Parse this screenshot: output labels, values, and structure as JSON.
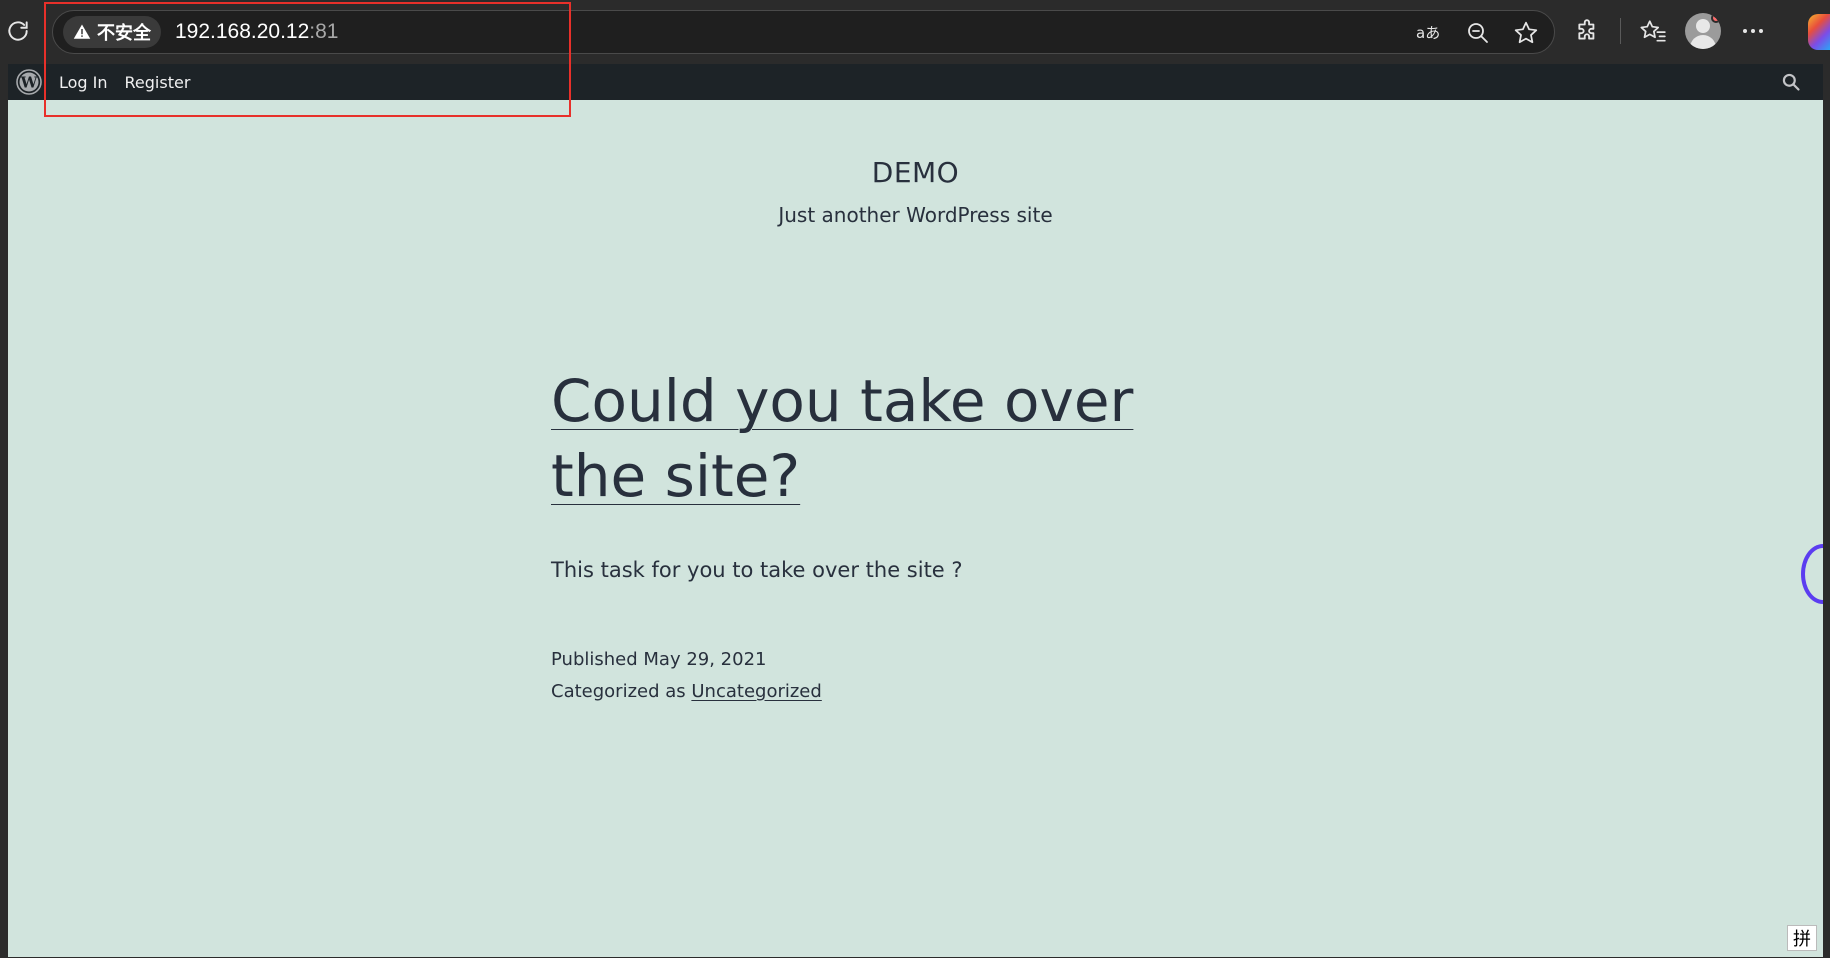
{
  "browser": {
    "security_label": "不安全",
    "url_host": "192.168.20.12",
    "url_port": ":81",
    "icons": [
      "reload-icon",
      "warning-icon",
      "read-aloud-icon",
      "zoom-out-icon",
      "favorite-star-icon",
      "extensions-icon",
      "favorites-icon",
      "profile-avatar-icon",
      "more-icon",
      "copilot-icon"
    ]
  },
  "admin_bar": {
    "login": "Log In",
    "register": "Register"
  },
  "site": {
    "title": "DEMO",
    "tagline": "Just another WordPress site"
  },
  "post": {
    "title": "Could you take over the site?",
    "content": "This task for you to take over the site ?",
    "published": "Published May 29, 2021",
    "categorized_prefix": "Categorized as ",
    "category": "Uncategorized"
  },
  "ime": {
    "label": "拼"
  },
  "colors": {
    "page_bg": "#d1e4dd",
    "text": "#28303d",
    "admin_bar": "#1d2327",
    "annotation": "#e8302a"
  }
}
